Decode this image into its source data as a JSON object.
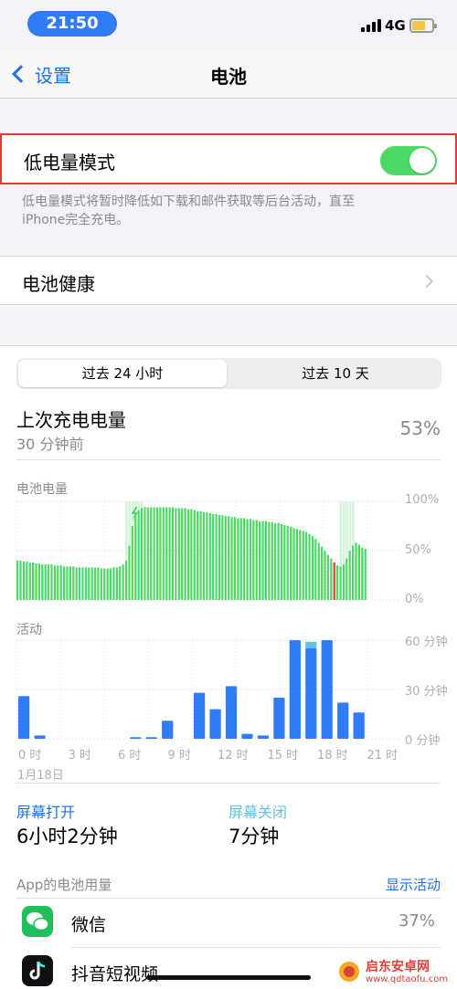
{
  "status": {
    "time": "21:50",
    "network": "4G"
  },
  "nav": {
    "back_label": "设置",
    "title": "电池"
  },
  "low_power": {
    "label": "低电量模式",
    "enabled": true,
    "description_line1": "低电量模式将暂时降低如下载和邮件获取等后台活动，直至",
    "description_line2": "iPhone完全充电。"
  },
  "battery_health": {
    "label": "电池健康"
  },
  "segments": {
    "active": "过去 24 小时",
    "other": "过去 10 天"
  },
  "last_charge": {
    "title": "上次充电电量",
    "subtitle": "30 分钟前",
    "value": "53%"
  },
  "colors": {
    "accent": "#1f6fe5",
    "green": "#4cd964",
    "bar_blue": "#2f7cf6",
    "red": "#e53935"
  },
  "chart_data": [
    {
      "type": "bar",
      "title": "电池电量",
      "y_ticks": [
        "100%",
        "50%",
        "0%"
      ],
      "ylim": [
        0,
        100
      ],
      "values": [
        40,
        40,
        39,
        39,
        38,
        38,
        37,
        37,
        36,
        36,
        36,
        36,
        35,
        35,
        35,
        34,
        34,
        34,
        34,
        33,
        33,
        33,
        33,
        33,
        33,
        33,
        33,
        32,
        32,
        32,
        32,
        33,
        33,
        34,
        36,
        40,
        55,
        75,
        87,
        91,
        93,
        94,
        94,
        94,
        94,
        94,
        94,
        94,
        94,
        94,
        94,
        93,
        93,
        93,
        93,
        92,
        92,
        91,
        90,
        90,
        89,
        89,
        88,
        87,
        87,
        86,
        86,
        85,
        85,
        84,
        84,
        83,
        83,
        83,
        82,
        82,
        81,
        81,
        80,
        80,
        80,
        79,
        79,
        78,
        78,
        77,
        76,
        75,
        74,
        73,
        72,
        71,
        70,
        69,
        67,
        65,
        62,
        58,
        54,
        50,
        46,
        42,
        38,
        35,
        34,
        36,
        42,
        50,
        55,
        58,
        56,
        53,
        52
      ],
      "charging_index": [
        35,
        36,
        37,
        38,
        39,
        40,
        104,
        105,
        106,
        107,
        108
      ],
      "low_index": [
        102
      ]
    },
    {
      "type": "bar",
      "title": "活动",
      "y_ticks": [
        "60 分钟",
        "30 分钟",
        "0 分钟"
      ],
      "ylim": [
        0,
        60
      ],
      "x_ticks": [
        "0 时",
        "3 时",
        "6 时",
        "9 时",
        "12 时",
        "15 时",
        "18 时",
        "21 时"
      ],
      "x_sub": "1月18日",
      "values": [
        26,
        2,
        0,
        0,
        0,
        0,
        0,
        1,
        1,
        11,
        0,
        28,
        18,
        32,
        3,
        2,
        25,
        60,
        55,
        60,
        22,
        16
      ],
      "light_values": [
        0,
        0,
        0,
        0,
        0,
        0,
        0,
        0,
        0,
        0,
        0,
        0,
        0,
        0,
        0,
        0,
        0,
        0,
        4,
        0,
        0,
        0
      ]
    }
  ],
  "screen_stats": {
    "on_label": "屏幕打开",
    "on_value": "6小时2分钟",
    "off_label": "屏幕关闭",
    "off_value": "7分钟"
  },
  "apps_header": {
    "title": "App的电池用量",
    "link": "显示活动"
  },
  "apps": [
    {
      "name": "微信",
      "pct": "37%",
      "icon": "wechat-icon"
    },
    {
      "name": "抖音短视频",
      "pct": "",
      "icon": "douyin-icon"
    }
  ],
  "watermark": {
    "name": "启东安卓网",
    "site": "www.qdtaofu.com"
  }
}
